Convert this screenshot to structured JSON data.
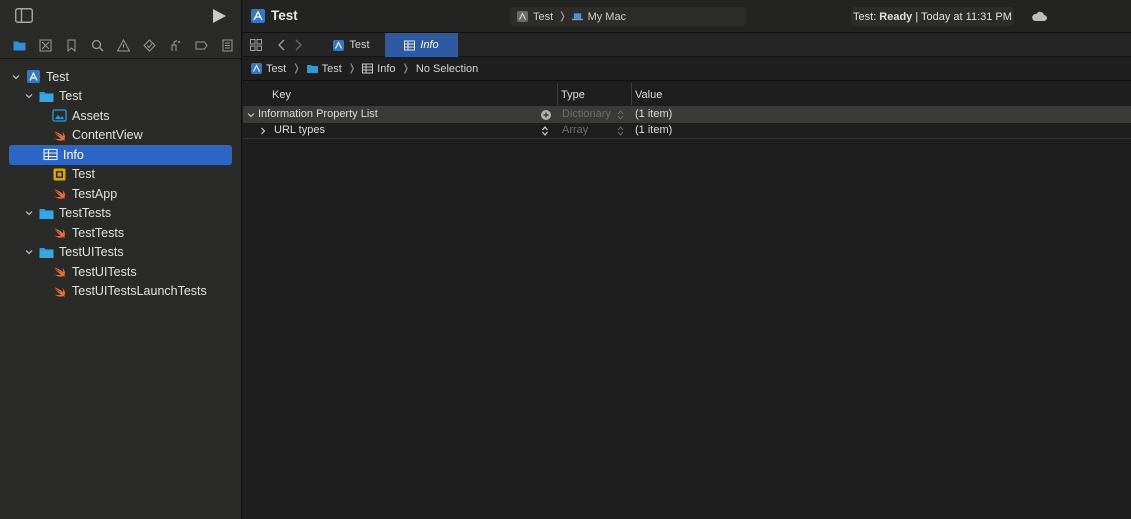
{
  "sidebar": {
    "tree": [
      {
        "label": "Test",
        "icon": "project-icon",
        "level": 0,
        "expanded": true
      },
      {
        "label": "Test",
        "icon": "folder-icon",
        "level": 1,
        "expanded": true
      },
      {
        "label": "Assets",
        "icon": "assets-icon",
        "level": 2
      },
      {
        "label": "ContentView",
        "icon": "swift-icon",
        "level": 2
      },
      {
        "label": "Info",
        "icon": "plist-icon",
        "level": 2,
        "selected": true
      },
      {
        "label": "Test",
        "icon": "entitlements-icon",
        "level": 2
      },
      {
        "label": "TestApp",
        "icon": "swift-icon",
        "level": 2
      },
      {
        "label": "TestTests",
        "icon": "folder-icon",
        "level": 1,
        "expanded": true
      },
      {
        "label": "TestTests",
        "icon": "swift-icon",
        "level": 2
      },
      {
        "label": "TestUITests",
        "icon": "folder-icon",
        "level": 1,
        "expanded": true
      },
      {
        "label": "TestUITests",
        "icon": "swift-icon",
        "level": 2
      },
      {
        "label": "TestUITestsLaunchTests",
        "icon": "swift-icon",
        "level": 2
      }
    ]
  },
  "toolbar": {
    "project_title": "Test",
    "scheme_target": "Test",
    "scheme_device": "My Mac",
    "status_prefix": "Test:",
    "status_state": "Ready",
    "status_suffix": "| Today at 11:31 PM"
  },
  "tabs": [
    {
      "label": "Test",
      "icon": "project-icon"
    },
    {
      "label": "Info",
      "icon": "plist-icon",
      "active": true
    }
  ],
  "breadcrumb": {
    "items": [
      "Test",
      "Test",
      "Info",
      "No Selection"
    ]
  },
  "plist": {
    "headers": {
      "key": "Key",
      "type": "Type",
      "value": "Value"
    },
    "rows": [
      {
        "key": "Information Property List",
        "type": "Dictionary",
        "value": "(1 item)"
      },
      {
        "key": "URL types",
        "type": "Array",
        "value": "(1 item)"
      }
    ]
  },
  "colors": {
    "accent": "#2b65c6",
    "folder": "#2f9ad8",
    "swift": "#ef6a33",
    "project": "#3478c4"
  }
}
